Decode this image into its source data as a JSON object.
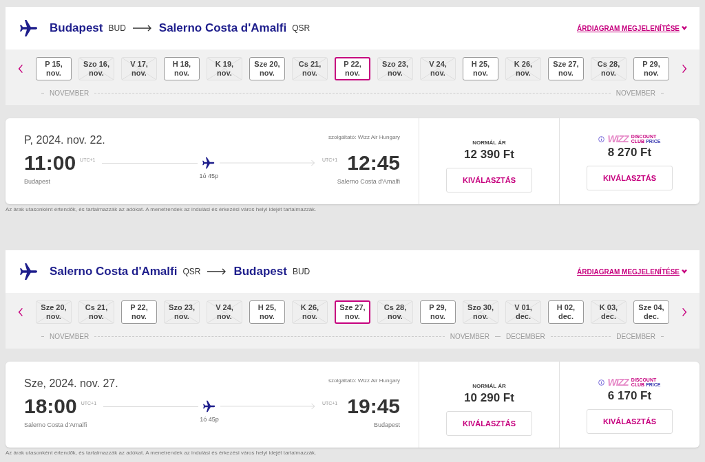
{
  "sections": [
    {
      "route": {
        "from_city": "Budapest",
        "from_code": "BUD",
        "to_city": "Salerno Costa d'Amalfi",
        "to_code": "QSR"
      },
      "chart_link": "ÁRDIAGRAM MEGJELENÍTÉSE",
      "dates": [
        {
          "day": "P 15,",
          "month": "nov.",
          "available": true,
          "selected": false
        },
        {
          "day": "Szo 16,",
          "month": "nov.",
          "available": false,
          "selected": false
        },
        {
          "day": "V 17,",
          "month": "nov.",
          "available": false,
          "selected": false
        },
        {
          "day": "H 18,",
          "month": "nov.",
          "available": true,
          "selected": false
        },
        {
          "day": "K 19,",
          "month": "nov.",
          "available": false,
          "selected": false
        },
        {
          "day": "Sze 20,",
          "month": "nov.",
          "available": true,
          "selected": false
        },
        {
          "day": "Cs 21,",
          "month": "nov.",
          "available": false,
          "selected": false
        },
        {
          "day": "P 22,",
          "month": "nov.",
          "available": true,
          "selected": true
        },
        {
          "day": "Szo 23,",
          "month": "nov.",
          "available": false,
          "selected": false
        },
        {
          "day": "V 24,",
          "month": "nov.",
          "available": false,
          "selected": false
        },
        {
          "day": "H 25,",
          "month": "nov.",
          "available": true,
          "selected": false
        },
        {
          "day": "K 26,",
          "month": "nov.",
          "available": false,
          "selected": false
        },
        {
          "day": "Sze 27,",
          "month": "nov.",
          "available": true,
          "selected": false
        },
        {
          "day": "Cs 28,",
          "month": "nov.",
          "available": false,
          "selected": false
        },
        {
          "day": "P 29,",
          "month": "nov.",
          "available": true,
          "selected": false
        }
      ],
      "month_segments": [
        {
          "start": "NOVEMBER",
          "end": "NOVEMBER"
        }
      ],
      "flight": {
        "date": "P, 2024. nov. 22.",
        "operator": "szolgáltató: Wizz Air Hungary",
        "dep_time": "11:00",
        "dep_tz": "UTC+1",
        "dep_city": "Budapest",
        "duration": "1ó 45p",
        "arr_time": "12:45",
        "arr_tz": "UTC+1",
        "arr_city": "Salerno Costa d'Amalfi"
      },
      "normal": {
        "label": "NORMÁL ÁR",
        "price": "12 390 Ft",
        "button": "KIVÁLASZTÁS"
      },
      "club": {
        "logo": "WIZZ",
        "line1": "DISCOUNT",
        "line2a": "CLUB",
        "line2b": "PRICE",
        "price": "8 270 Ft",
        "button": "KIVÁLASZTÁS"
      },
      "note": "Az árak utasonként értendők, és tartalmazzák az adókat. A menetrendek az indulási és érkezési város helyi idejét tartalmazzák."
    },
    {
      "route": {
        "from_city": "Salerno Costa d'Amalfi",
        "from_code": "QSR",
        "to_city": "Budapest",
        "to_code": "BUD"
      },
      "chart_link": "ÁRDIAGRAM MEGJELENÍTÉSE",
      "dates": [
        {
          "day": "Sze 20,",
          "month": "nov.",
          "available": false,
          "selected": false
        },
        {
          "day": "Cs 21,",
          "month": "nov.",
          "available": false,
          "selected": false
        },
        {
          "day": "P 22,",
          "month": "nov.",
          "available": true,
          "selected": false
        },
        {
          "day": "Szo 23,",
          "month": "nov.",
          "available": false,
          "selected": false
        },
        {
          "day": "V 24,",
          "month": "nov.",
          "available": false,
          "selected": false
        },
        {
          "day": "H 25,",
          "month": "nov.",
          "available": true,
          "selected": false
        },
        {
          "day": "K 26,",
          "month": "nov.",
          "available": false,
          "selected": false
        },
        {
          "day": "Sze 27,",
          "month": "nov.",
          "available": true,
          "selected": true
        },
        {
          "day": "Cs 28,",
          "month": "nov.",
          "available": false,
          "selected": false
        },
        {
          "day": "P 29,",
          "month": "nov.",
          "available": true,
          "selected": false
        },
        {
          "day": "Szo 30,",
          "month": "nov.",
          "available": false,
          "selected": false
        },
        {
          "day": "V 01,",
          "month": "dec.",
          "available": false,
          "selected": false
        },
        {
          "day": "H 02,",
          "month": "dec.",
          "available": true,
          "selected": false
        },
        {
          "day": "K 03,",
          "month": "dec.",
          "available": false,
          "selected": false
        },
        {
          "day": "Sze 04,",
          "month": "dec.",
          "available": true,
          "selected": false
        }
      ],
      "month_segments": [
        {
          "start": "NOVEMBER",
          "end": "NOVEMBER"
        },
        {
          "start": "DECEMBER",
          "end": "DECEMBER"
        }
      ],
      "flight": {
        "date": "Sze, 2024. nov. 27.",
        "operator": "szolgáltató: Wizz Air Hungary",
        "dep_time": "18:00",
        "dep_tz": "UTC+1",
        "dep_city": "Salerno Costa d'Amalfi",
        "duration": "1ó 45p",
        "arr_time": "19:45",
        "arr_tz": "UTC+1",
        "arr_city": "Budapest"
      },
      "normal": {
        "label": "NORMÁL ÁR",
        "price": "10 290 Ft",
        "button": "KIVÁLASZTÁS"
      },
      "club": {
        "logo": "WIZZ",
        "line1": "DISCOUNT",
        "line2a": "CLUB",
        "line2b": "PRICE",
        "price": "6 170 Ft",
        "button": "KIVÁLASZTÁS"
      },
      "note": "Az árak utasonként értendők, és tartalmazzák az adókat. A menetrendek az indulási és érkezési város helyi idejét tartalmazzák."
    }
  ]
}
